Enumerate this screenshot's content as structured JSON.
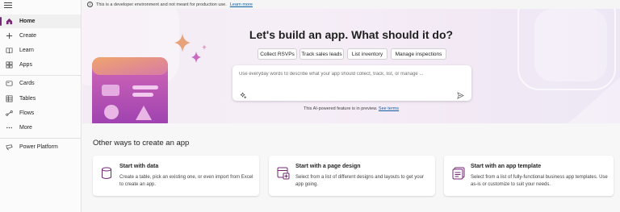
{
  "dev_banner": {
    "text": "This is a developer environment and not meant for production use.",
    "link": "Learn more"
  },
  "sidebar": {
    "items": [
      {
        "label": "Home",
        "icon": "home-icon"
      },
      {
        "label": "Create",
        "icon": "plus-icon"
      },
      {
        "label": "Learn",
        "icon": "book-icon"
      },
      {
        "label": "Apps",
        "icon": "apps-icon"
      },
      {
        "label": "Cards",
        "icon": "cards-icon"
      },
      {
        "label": "Tables",
        "icon": "table-icon"
      },
      {
        "label": "Flows",
        "icon": "flow-icon"
      },
      {
        "label": "More",
        "icon": "more-icon"
      },
      {
        "label": "Power Platform",
        "icon": "power-platform-icon"
      }
    ]
  },
  "hero": {
    "title": "Let's build an app. What should it do?",
    "suggestions": [
      "Collect RSVPs",
      "Track sales leads",
      "List inventory",
      "Manage inspections"
    ],
    "prompt_placeholder": "Use everyday words to describe what your app should collect, track, list, or manage ...",
    "preview_note": "This AI-powered feature is in preview.",
    "preview_link": "See terms"
  },
  "other_ways": {
    "title": "Other ways to create an app",
    "cards": [
      {
        "title": "Start with data",
        "description": "Create a table, pick an existing one, or even import from Excel to create an app.",
        "icon": "database-icon"
      },
      {
        "title": "Start with a page design",
        "description": "Select from a list of different designs and layouts to get your app going.",
        "icon": "page-design-icon"
      },
      {
        "title": "Start with an app template",
        "description": "Select from a list of fully-functional business app templates. Use as-is or customize to suit your needs.",
        "icon": "app-template-icon"
      }
    ]
  },
  "colors": {
    "accent": "#742774",
    "link": "#115ea3"
  }
}
